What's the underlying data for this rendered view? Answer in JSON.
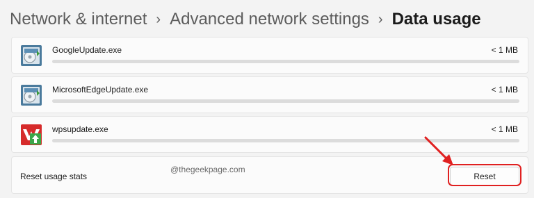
{
  "breadcrumb": {
    "items": [
      "Network & internet",
      "Advanced network settings"
    ],
    "current": "Data usage",
    "separator": "›"
  },
  "apps": [
    {
      "name": "GoogleUpdate.exe",
      "usage": "< 1 MB",
      "icon": "google-update-app-icon"
    },
    {
      "name": "MicrosoftEdgeUpdate.exe",
      "usage": "< 1 MB",
      "icon": "edge-update-app-icon"
    },
    {
      "name": "wpsupdate.exe",
      "usage": "< 1 MB",
      "icon": "wps-update-app-icon"
    }
  ],
  "reset": {
    "label": "Reset usage stats",
    "button": "Reset",
    "watermark": "@thegeekpage.com"
  },
  "colors": {
    "accent": "#0067c0",
    "annotation": "#e02020"
  }
}
